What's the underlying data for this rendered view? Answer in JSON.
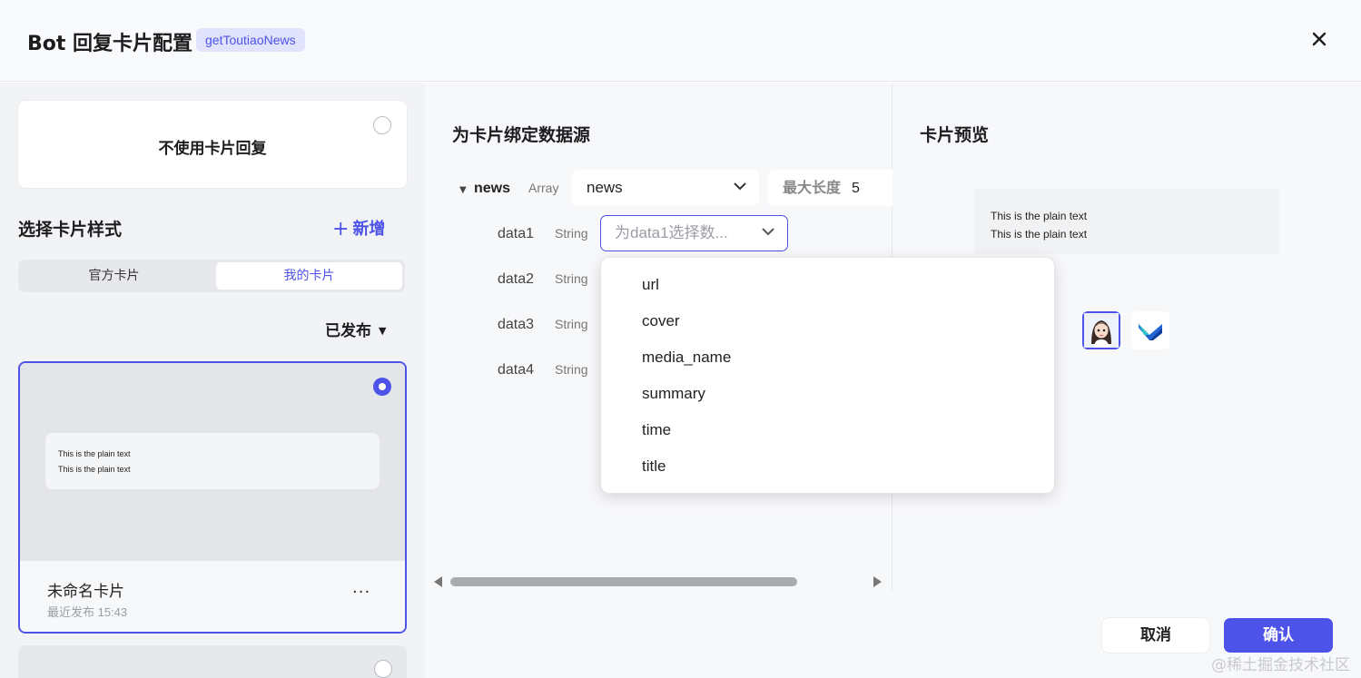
{
  "dialog": {
    "title": "Bot 回复卡片配置",
    "function_badge": "getToutiaoNews",
    "close_icon": "close-icon"
  },
  "left": {
    "no_card_label": "不使用卡片回复",
    "section_title": "选择卡片样式",
    "add_label": "新增",
    "tabs": [
      {
        "label": "官方卡片",
        "active": false
      },
      {
        "label": "我的卡片",
        "active": true
      }
    ],
    "filter_label": "已发布",
    "cards": [
      {
        "name": "未命名卡片",
        "published": "最近发布 15:43",
        "preview_lines": [
          "This is the plain text",
          "This is the plain text"
        ],
        "more": "···",
        "selected": true
      }
    ]
  },
  "binding": {
    "title": "为卡片绑定数据源",
    "root": {
      "name": "news",
      "type": "Array",
      "value": "news",
      "max_len_label": "最大长度",
      "max_len_value": "5"
    },
    "fields": [
      {
        "name": "data1",
        "type": "String",
        "placeholder": "为data1选择数..."
      },
      {
        "name": "data2",
        "type": "String"
      },
      {
        "name": "data3",
        "type": "String"
      },
      {
        "name": "data4",
        "type": "String"
      }
    ],
    "dropdown_options": [
      "url",
      "cover",
      "media_name",
      "summary",
      "time",
      "title"
    ]
  },
  "preview": {
    "title": "卡片预览",
    "lines": [
      "This is the plain text",
      "This is the plain text"
    ],
    "avatars": [
      "girl-avatar-icon",
      "app-logo-icon"
    ]
  },
  "footer": {
    "cancel": "取消",
    "confirm": "确认"
  },
  "watermark": "@稀土掘金技术社区",
  "colors": {
    "accent": "#4d53e8"
  }
}
